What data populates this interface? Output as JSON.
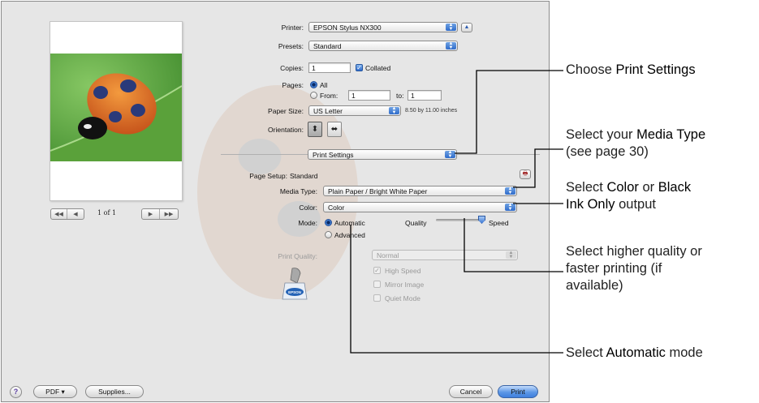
{
  "printer": {
    "label": "Printer:",
    "value": "EPSON Stylus NX300"
  },
  "presets": {
    "label": "Presets:",
    "value": "Standard"
  },
  "copies": {
    "label": "Copies:",
    "value": "1",
    "collated_label": "Collated",
    "collated": true
  },
  "pages": {
    "label": "Pages:",
    "all_label": "All",
    "from_label": "From:",
    "from_value": "1",
    "to_label": "to:",
    "to_value": "1",
    "selected": "All"
  },
  "paper_size": {
    "label": "Paper Size:",
    "value": "US Letter",
    "dimensions": "8.50 by 11.00 inches"
  },
  "orientation": {
    "label": "Orientation:",
    "selected": "portrait"
  },
  "panel": {
    "value": "Print Settings"
  },
  "page_setup": {
    "label": "Page Setup:",
    "value": "Standard"
  },
  "media_type": {
    "label": "Media Type:",
    "value": "Plain Paper / Bright White Paper"
  },
  "color": {
    "label": "Color:",
    "value": "Color"
  },
  "mode": {
    "label": "Mode:",
    "automatic_label": "Automatic",
    "advanced_label": "Advanced",
    "selected": "Automatic",
    "quality_label": "Quality",
    "speed_label": "Speed",
    "slider_level": 1.0
  },
  "print_quality": {
    "label": "Print Quality:",
    "value": "Normal",
    "enabled": false
  },
  "options": [
    {
      "label": "High Speed",
      "checked": true
    },
    {
      "label": "Mirror Image",
      "checked": false
    },
    {
      "label": "Quiet Mode",
      "checked": false
    }
  ],
  "preview": {
    "page_count": "1 of 1"
  },
  "buttons": {
    "pdf": "PDF ▾",
    "supplies": "Supplies...",
    "cancel": "Cancel",
    "print": "Print",
    "help": "?"
  },
  "logo_text": "EPSON",
  "callouts": {
    "print_settings": {
      "pre": "Choose ",
      "bold": "Print Settings",
      "post": ""
    },
    "media_type": {
      "pre": "Select your ",
      "bold": "Media Type",
      "post": "(see page 30)"
    },
    "color": {
      "pre": "Select ",
      "bold1": "Color",
      "mid": " or ",
      "bold2": "Black",
      "line2_bold": "Ink Only",
      "line2_post": " output"
    },
    "quality": {
      "line1": "Select higher quality or",
      "line2": "faster printing (if",
      "line3": "available)"
    },
    "automatic": {
      "pre": "Select ",
      "bold": "Automatic",
      "post": " mode"
    }
  },
  "colors": {
    "accent": "#3f7fdd",
    "dialog_bg": "#e6e6e6",
    "callout_line": "#000000"
  }
}
